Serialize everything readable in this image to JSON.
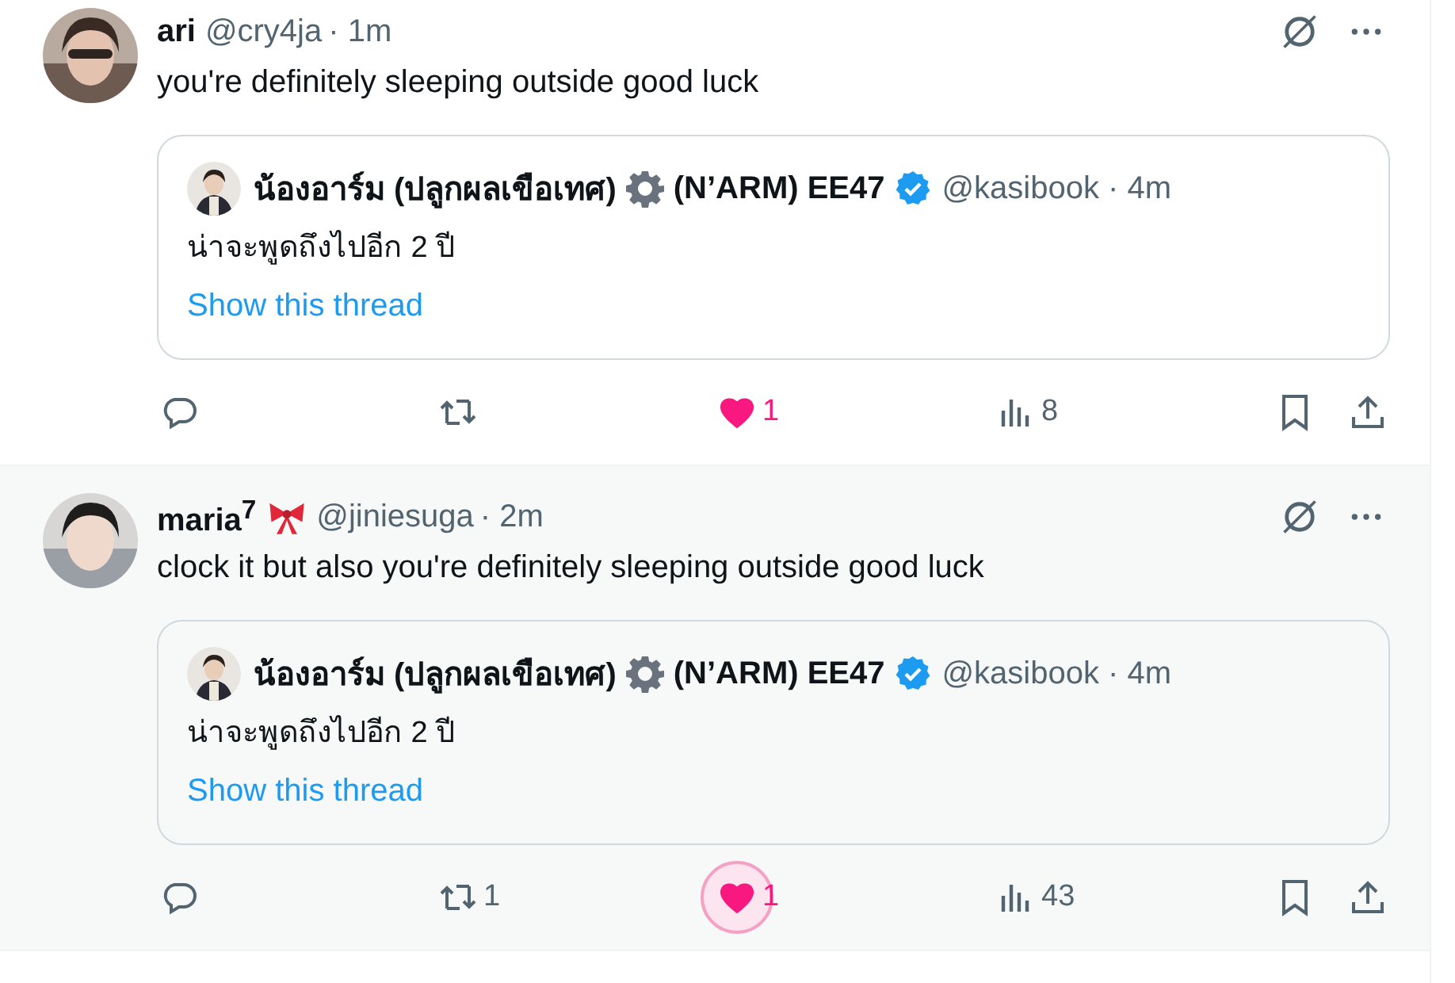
{
  "tweets": [
    {
      "name": "ari",
      "handle": "@cry4ja",
      "time": "· 1m",
      "highlighted": false,
      "text": "you're definitely sleeping outside good luck",
      "quote": {
        "name_parts": [
          "น้องอาร์ม (ปลูกผลเขือเทศ)",
          "(N’ARM) EE47"
        ],
        "verified": true,
        "handle": "@kasibook · 4m",
        "text": "น่าจะพูดถึงไปอีก 2 ปี",
        "link": "Show this thread"
      },
      "actions": [
        {
          "kind": "reply"
        },
        {
          "kind": "retweet"
        },
        {
          "kind": "like",
          "count": "1",
          "liked": true,
          "focused": false
        },
        {
          "kind": "views",
          "count": "8"
        },
        {
          "kind": "bookmark"
        },
        {
          "kind": "share"
        }
      ]
    },
    {
      "name": "maria$^{7}$",
      "handle": "@jiniesuga",
      "time": "· 2m",
      "bow_badge": true,
      "highlighted": true,
      "text": "clock it but also you're definitely sleeping outside good luck",
      "quote": {
        "name_parts": [
          "น้องอาร์ม (ปลูกผลเขือเทศ)",
          "(N’ARM) EE47"
        ],
        "verified": true,
        "handle": "@kasibook · 4m",
        "text": "น่าจะพูดถึงไปอีก 2 ปี",
        "link": "Show this thread"
      },
      "actions": [
        {
          "kind": "reply"
        },
        {
          "kind": "retweet",
          "count": "1"
        },
        {
          "kind": "like",
          "count": "1",
          "liked": true,
          "focused": true
        },
        {
          "kind": "views",
          "count": "43"
        },
        {
          "kind": "bookmark"
        },
        {
          "kind": "share"
        }
      ]
    }
  ]
}
